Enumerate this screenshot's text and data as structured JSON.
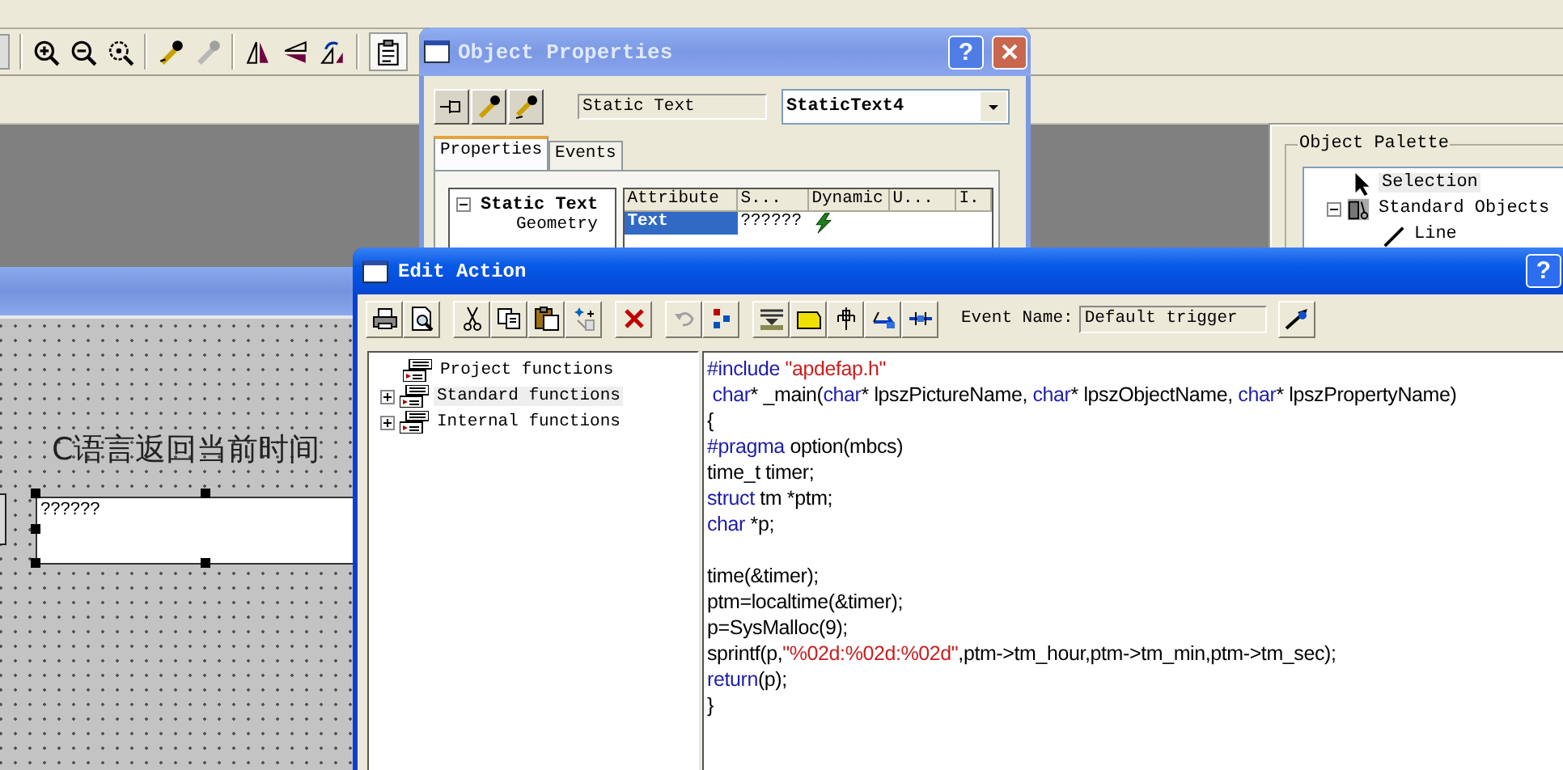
{
  "picture_window": {
    "heading": "C语言返回当前时间",
    "text_field": "??????"
  },
  "object_properties": {
    "title": "Object Properties",
    "help_button": "?",
    "object_type": "Static Text",
    "object_name": "StaticText4",
    "tabs": [
      {
        "label": "Properties",
        "selected": true
      },
      {
        "label": "Events",
        "selected": false
      }
    ],
    "tree": {
      "label": "Static Text",
      "expanded": true,
      "children": [
        {
          "label": "Geometry"
        }
      ]
    },
    "table": {
      "columns": [
        "Attribute",
        "S...",
        "Dynamic",
        "U...",
        "I."
      ],
      "rows": [
        {
          "attribute": "Text",
          "static": "??????",
          "selected": true
        }
      ]
    }
  },
  "object_palette": {
    "title": "Object Palette",
    "items": [
      {
        "kind": "leaf",
        "label": "Selection",
        "selected": true
      },
      {
        "kind": "group",
        "label": "Standard Objects",
        "selected": false,
        "expanded": true,
        "children": [
          {
            "label": "Line"
          }
        ]
      }
    ]
  },
  "edit_action": {
    "title": "Edit Action",
    "help_button": "?",
    "event_name_label": "Event Name:",
    "event_name": "Default trigger",
    "functions": [
      {
        "kind": "leaf",
        "label": "Project functions",
        "selected": false
      },
      {
        "kind": "group",
        "label": "Standard functions",
        "expanded": false,
        "selected": true
      },
      {
        "kind": "group",
        "label": "Internal functions",
        "expanded": false,
        "selected": false
      }
    ],
    "code": [
      {
        "kind": "code",
        "tokens": [
          {
            "text": "#include",
            "kind": "keyword"
          },
          {
            "text": " \"apdefap.h\"",
            "kind": "string"
          }
        ]
      },
      {
        "kind": "code",
        "tokens": [
          {
            "text": " char",
            "kind": "keyword"
          },
          {
            "text": "* _main(",
            "kind": "plain"
          },
          {
            "text": "char",
            "kind": "keyword"
          },
          {
            "text": "* lpszPictureName, ",
            "kind": "plain"
          },
          {
            "text": "char",
            "kind": "keyword"
          },
          {
            "text": "* lpszObjectName, ",
            "kind": "plain"
          },
          {
            "text": "char",
            "kind": "keyword"
          },
          {
            "text": "* lpszPropertyName)",
            "kind": "plain"
          }
        ]
      },
      {
        "kind": "code",
        "tokens": [
          {
            "text": "{",
            "kind": "plain"
          }
        ]
      },
      {
        "kind": "code",
        "tokens": [
          {
            "text": "#pragma",
            "kind": "keyword"
          },
          {
            "text": " option(mbcs)",
            "kind": "plain"
          }
        ]
      },
      {
        "kind": "code",
        "tokens": [
          {
            "text": "time_t timer;",
            "kind": "plain"
          }
        ]
      },
      {
        "kind": "code",
        "tokens": [
          {
            "text": "struct",
            "kind": "keyword"
          },
          {
            "text": " tm *ptm;",
            "kind": "plain"
          }
        ]
      },
      {
        "kind": "code",
        "tokens": [
          {
            "text": "char",
            "kind": "keyword"
          },
          {
            "text": " *p;",
            "kind": "plain"
          }
        ]
      },
      {
        "kind": "blank"
      },
      {
        "kind": "code",
        "tokens": [
          {
            "text": "time(&timer);",
            "kind": "plain"
          }
        ]
      },
      {
        "kind": "code",
        "tokens": [
          {
            "text": "ptm=localtime(&timer);",
            "kind": "plain"
          }
        ]
      },
      {
        "kind": "code",
        "tokens": [
          {
            "text": "p=SysMalloc(9);",
            "kind": "plain"
          }
        ]
      },
      {
        "kind": "code",
        "tokens": [
          {
            "text": "sprintf(p,",
            "kind": "plain"
          },
          {
            "text": "\"%02d:%02d:%02d\"",
            "kind": "string"
          },
          {
            "text": ",ptm->tm_hour,ptm->tm_min,ptm->tm_sec);",
            "kind": "plain"
          }
        ]
      },
      {
        "kind": "code",
        "tokens": [
          {
            "text": "return",
            "kind": "keyword"
          },
          {
            "text": "(p);",
            "kind": "plain"
          }
        ]
      },
      {
        "kind": "code",
        "tokens": [
          {
            "text": "}",
            "kind": "plain"
          }
        ]
      }
    ]
  }
}
